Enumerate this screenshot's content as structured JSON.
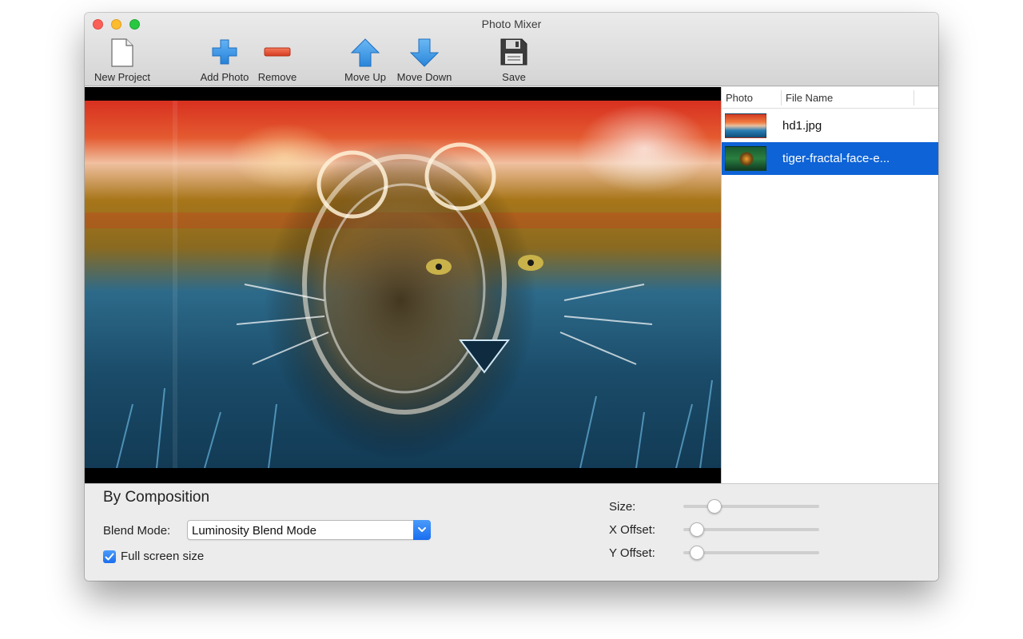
{
  "window": {
    "title": "Photo Mixer"
  },
  "toolbar": [
    {
      "label": "New Project",
      "icon": "document-icon"
    },
    {
      "label": "Add Photo",
      "icon": "plus-icon"
    },
    {
      "label": "Remove",
      "icon": "minus-icon"
    },
    {
      "label": "Move Up",
      "icon": "arrow-up-icon"
    },
    {
      "label": "Move Down",
      "icon": "arrow-down-icon"
    },
    {
      "label": "Save",
      "icon": "floppy-disk-icon"
    }
  ],
  "photo_list": {
    "columns": [
      "Photo",
      "File Name"
    ],
    "rows": [
      {
        "file_name": "hd1.jpg",
        "selected": false
      },
      {
        "file_name": "tiger-fractal-face-e...",
        "selected": true
      }
    ]
  },
  "controls": {
    "section_title": "By Composition",
    "blend_mode_label": "Blend Mode:",
    "blend_mode_value": "Luminosity Blend Mode",
    "full_screen_label": "Full screen size",
    "full_screen_checked": true,
    "sliders": [
      {
        "label": "Size:",
        "value": 0.2
      },
      {
        "label": "X Offset:",
        "value": 0.05
      },
      {
        "label": "Y Offset:",
        "value": 0.05
      }
    ]
  },
  "colors": {
    "selection": "#0e63d6",
    "accent_blue": "#1a6ef0",
    "close": "#fc5f57",
    "minimize": "#fdbc2e",
    "maximize": "#29c840"
  }
}
